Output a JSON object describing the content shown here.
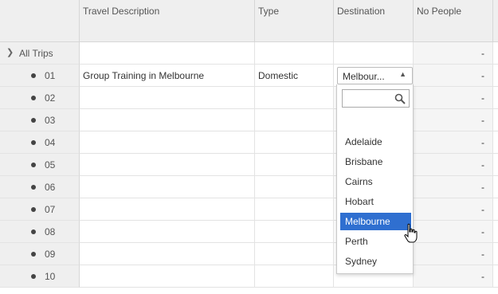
{
  "columns": [
    "Travel Description",
    "Type",
    "Destination",
    "No People"
  ],
  "group_row": {
    "label": "All Trips",
    "value": "-"
  },
  "rows": [
    {
      "num": "01",
      "description": "Group Training in Melbourne",
      "type": "Domestic",
      "people": "-"
    },
    {
      "num": "02",
      "description": "",
      "type": "",
      "people": "-"
    },
    {
      "num": "03",
      "description": "",
      "type": "",
      "people": "-"
    },
    {
      "num": "04",
      "description": "",
      "type": "",
      "people": "-"
    },
    {
      "num": "05",
      "description": "",
      "type": "",
      "people": "-"
    },
    {
      "num": "06",
      "description": "",
      "type": "",
      "people": "-"
    },
    {
      "num": "07",
      "description": "",
      "type": "",
      "people": "-"
    },
    {
      "num": "08",
      "description": "",
      "type": "",
      "people": "-"
    },
    {
      "num": "09",
      "description": "",
      "type": "",
      "people": "-"
    },
    {
      "num": "10",
      "description": "",
      "type": "",
      "people": "-"
    }
  ],
  "destination_select": {
    "value": "Melbour...",
    "search_value": "",
    "options": [
      "Adelaide",
      "Brisbane",
      "Cairns",
      "Hobart",
      "Melbourne",
      "Perth",
      "Sydney"
    ],
    "selected": "Melbourne"
  },
  "colors": {
    "header_bg": "#efefef",
    "selected": "#2f6fd0"
  },
  "icons": {
    "expand": "chevron-right-icon",
    "search": "search-icon",
    "row": "dot-icon",
    "select": "caret-up-icon",
    "cursor": "hand-cursor-icon"
  }
}
